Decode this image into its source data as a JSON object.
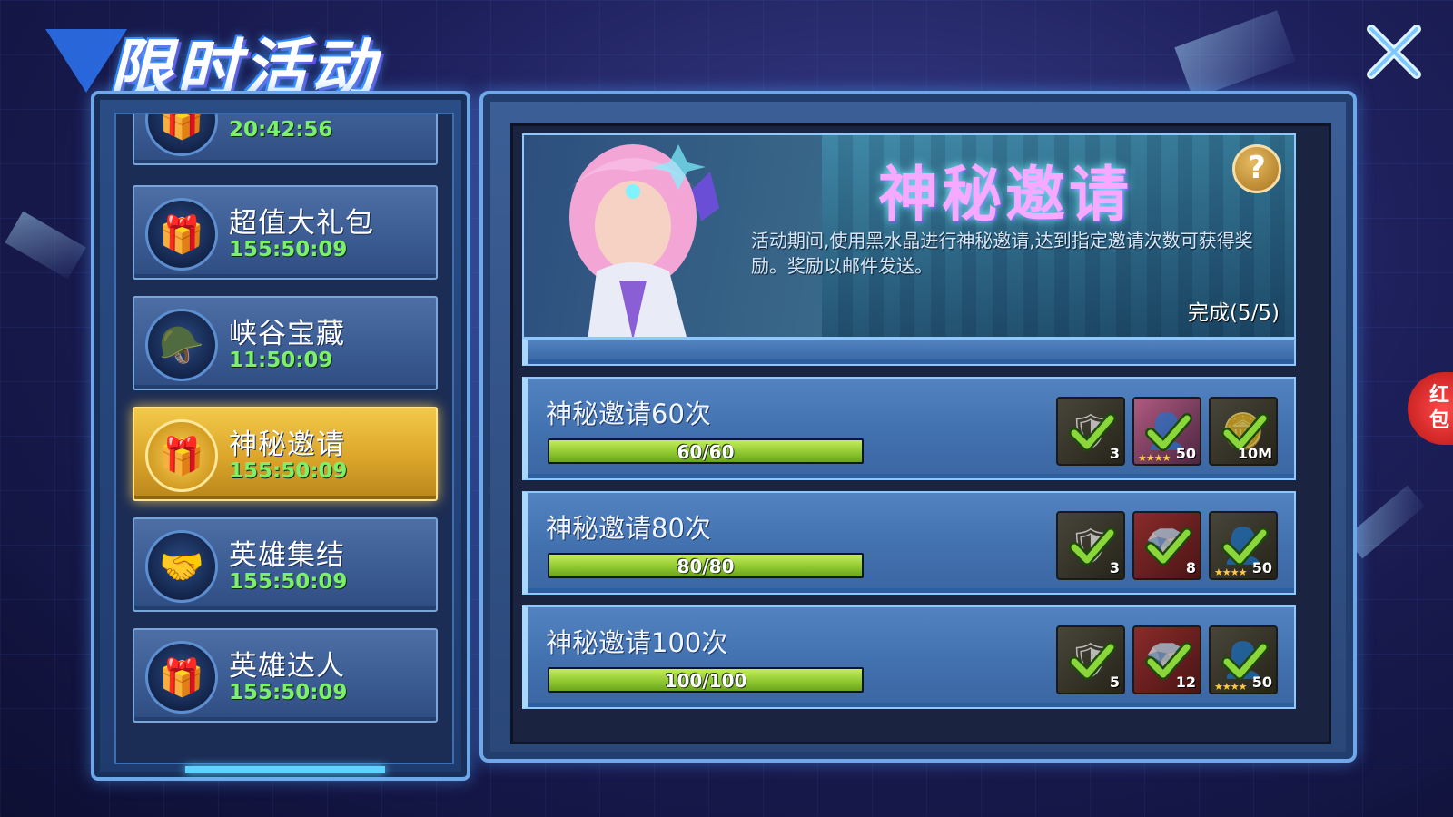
{
  "header": {
    "title": "限时活动",
    "close_icon": "close-icon"
  },
  "activities": [
    {
      "name": "",
      "time": "20:42:56",
      "icon": "🎁",
      "active": false
    },
    {
      "name": "超值大礼包",
      "time": "155:50:09",
      "icon": "🎁",
      "active": false
    },
    {
      "name": "峡谷宝藏",
      "time": "11:50:09",
      "icon": "🪖",
      "active": false
    },
    {
      "name": "神秘邀请",
      "time": "155:50:09",
      "icon": "🎁",
      "active": true
    },
    {
      "name": "英雄集结",
      "time": "155:50:09",
      "icon": "🤝",
      "active": false
    },
    {
      "name": "英雄达人",
      "time": "155:50:09",
      "icon": "🎁",
      "active": false
    }
  ],
  "banner": {
    "title": "神秘邀请",
    "description": "活动期间,使用黑水晶进行神秘邀请,达到指定邀请次数可获得奖励。奖励以邮件发送。",
    "progress": "完成(5/5)",
    "help_label": "?"
  },
  "tasks": [
    {
      "title": "神秘邀请60次",
      "progress_text": "60/60",
      "progress": 1.0,
      "rewards": [
        {
          "style": "dark",
          "glyph": "🛡",
          "qty": "3",
          "stars": ""
        },
        {
          "style": "pink",
          "glyph": "👤",
          "qty": "50",
          "stars": "★★★★"
        },
        {
          "style": "dark",
          "glyph": "🪙",
          "qty": "10M",
          "stars": ""
        }
      ]
    },
    {
      "title": "神秘邀请80次",
      "progress_text": "80/80",
      "progress": 1.0,
      "rewards": [
        {
          "style": "dark",
          "glyph": "🛡",
          "qty": "3",
          "stars": ""
        },
        {
          "style": "red",
          "glyph": "💎",
          "qty": "8",
          "stars": ""
        },
        {
          "style": "dark",
          "glyph": "👤",
          "qty": "50",
          "stars": "★★★★"
        }
      ]
    },
    {
      "title": "神秘邀请100次",
      "progress_text": "100/100",
      "progress": 1.0,
      "rewards": [
        {
          "style": "dark",
          "glyph": "🛡",
          "qty": "5",
          "stars": ""
        },
        {
          "style": "red",
          "glyph": "💎",
          "qty": "12",
          "stars": ""
        },
        {
          "style": "dark",
          "glyph": "👤",
          "qty": "50",
          "stars": "★★★★"
        }
      ]
    }
  ],
  "side_tab": {
    "label": "红包"
  },
  "colors": {
    "accent_gold": "#f2c94a",
    "timer_green": "#7df06a",
    "progress_green": "#8cc62e"
  }
}
